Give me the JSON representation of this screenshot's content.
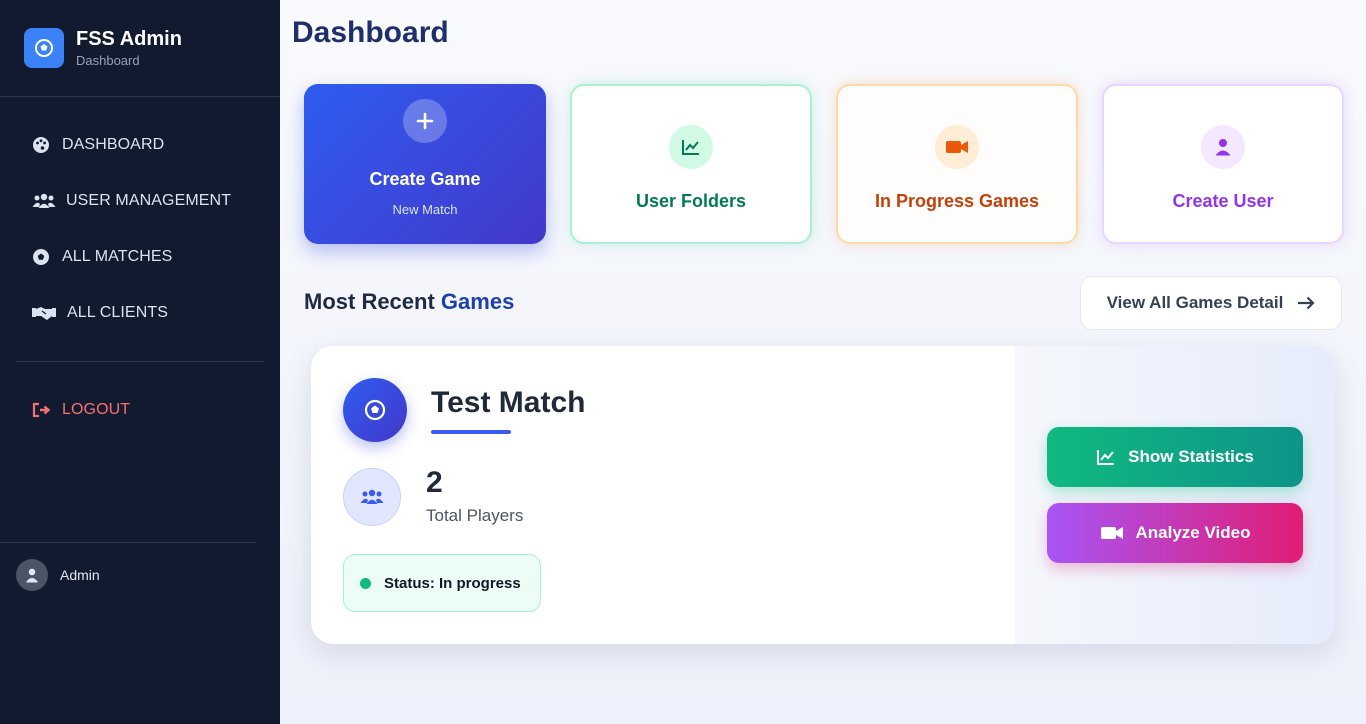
{
  "sidebar": {
    "brand_title": "FSS Admin",
    "brand_subtitle": "Dashboard",
    "items": [
      {
        "label": "DASHBOARD",
        "icon": "palette-icon"
      },
      {
        "label": "USER MANAGEMENT",
        "icon": "users-icon"
      },
      {
        "label": "ALL MATCHES",
        "icon": "soccer-ball-icon"
      },
      {
        "label": "ALL CLIENTS",
        "icon": "handshake-icon"
      }
    ],
    "logout_label": "LOGOUT",
    "user_name": "Admin"
  },
  "main": {
    "title": "Dashboard",
    "quick_actions": [
      {
        "label": "Create Game",
        "sublabel": "New Match",
        "icon": "plus-icon"
      },
      {
        "label": "User Folders",
        "icon": "chart-line-icon"
      },
      {
        "label": "In Progress Games",
        "icon": "video-icon"
      },
      {
        "label": "Create User",
        "icon": "user-icon"
      }
    ],
    "section_title_prefix": "Most Recent",
    "section_title_accent": "Games",
    "view_all_label": "View All Games Detail",
    "game": {
      "title": "Test Match",
      "players_count": "2",
      "players_label": "Total Players",
      "status": "Status: In progress",
      "show_statistics_label": "Show Statistics",
      "analyze_video_label": "Analyze Video"
    }
  },
  "colors": {
    "sidebar_bg": "#111a2e",
    "primary": "#3b5bf0",
    "green": "#10b981",
    "orange": "#c2410c",
    "purple": "#9333ea",
    "logout": "#f87171"
  }
}
